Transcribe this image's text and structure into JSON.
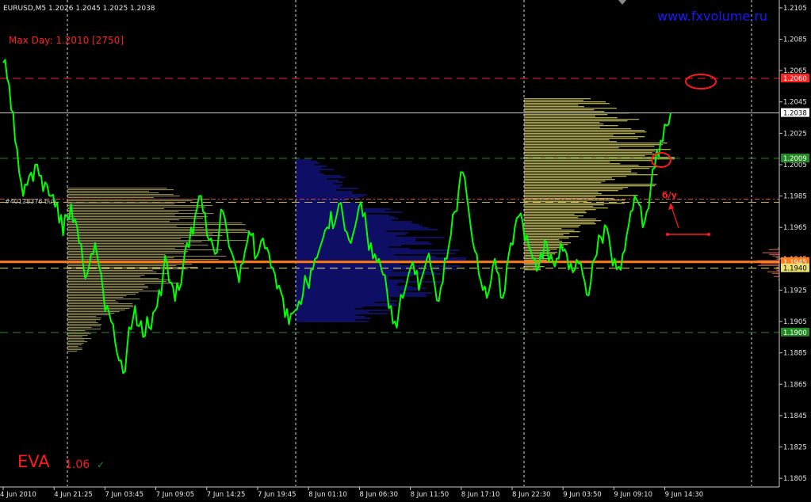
{
  "header": {
    "symbol_info": "EURUSD,M5  1.2026 1.2045 1.2025 1.2038",
    "website": "www.fxvolume.ru",
    "max_day": "Max Day: 1.2010 [2750]",
    "trade_label": "#40128376 buy",
    "annotation": "б/у"
  },
  "footer": {
    "brand": "EVA",
    "version": "1.06",
    "check": "✓"
  },
  "colors": {
    "background": "#000000",
    "price_line": "#00ff00",
    "volume_yellow": "#e8e070",
    "volume_khaki": "#a09a58",
    "volume_blue": "#1c1cc8",
    "volume_red": "#d86a5a",
    "level_red": "#ff2020",
    "level_green": "#228b22",
    "level_orange": "#ff7a1a",
    "brand_red": "#ff1a1a",
    "website_blue": "#1a1aff"
  },
  "chart_data": {
    "type": "line",
    "title": "EURUSD,M5",
    "y_ticks": [
      "1.2105",
      "1.2085",
      "1.2065",
      "1.2045",
      "1.2025",
      "1.2005",
      "1.1985",
      "1.1965",
      "1.1945",
      "1.1925",
      "1.1905",
      "1.1885",
      "1.1865",
      "1.1845",
      "1.1825",
      "1.1805"
    ],
    "x_ticks": [
      "4 Jun 2010",
      "4 Jun 21:25",
      "7 Jun 03:45",
      "7 Jun 09:05",
      "7 Jun 14:25",
      "7 Jun 19:45",
      "8 Jun 01:10",
      "8 Jun 06:30",
      "8 Jun 11:50",
      "8 Jun 17:10",
      "8 Jun 22:30",
      "9 Jun 03:50",
      "9 Jun 09:10",
      "9 Jun 14:30"
    ],
    "ylim": [
      1.18,
      1.211
    ],
    "levels": [
      {
        "price": 1.206,
        "label": "1.2060",
        "color": "#ff2020",
        "style": "dash"
      },
      {
        "price": 1.2038,
        "label": "1.2038",
        "color": "#c8c8c8",
        "style": "solid"
      },
      {
        "price": 1.2009,
        "label": "1.2009",
        "color": "#228b22",
        "style": "dash"
      },
      {
        "price": 1.1983,
        "label": "",
        "color": "#c85050",
        "style": "dashdot"
      },
      {
        "price": 1.1981,
        "label": "",
        "color": "#d0b040",
        "style": "dash"
      },
      {
        "price": 1.1943,
        "label": "1.1945",
        "color": "#ff7a1a",
        "style": "solid"
      },
      {
        "price": 1.1939,
        "label": "1.1940",
        "color": "#e8e070",
        "style": "dash"
      },
      {
        "price": 1.1898,
        "label": "1.1900",
        "color": "#228b22",
        "style": "dash"
      }
    ],
    "series": [
      {
        "values": [
          1.207,
          1.206,
          1.204,
          1.202,
          1.2,
          1.1985,
          1.1992,
          1.2,
          1.2005,
          1.1998,
          1.1988,
          1.1992,
          1.1985,
          1.1978,
          1.1968,
          1.196,
          1.1972,
          1.198,
          1.197,
          1.1955,
          1.1942,
          1.1935,
          1.1948,
          1.1955,
          1.194,
          1.1925,
          1.1915,
          1.1905,
          1.1892,
          1.188,
          1.1872,
          1.1888,
          1.19,
          1.1915,
          1.1902,
          1.1895,
          1.1908,
          1.19,
          1.1912,
          1.1925,
          1.1935,
          1.1942,
          1.193,
          1.1918,
          1.1925,
          1.194,
          1.1955,
          1.1965,
          1.1972,
          1.1985,
          1.1975,
          1.196,
          1.1958,
          1.1948,
          1.1962,
          1.1975,
          1.1962,
          1.195,
          1.1942,
          1.193,
          1.1942,
          1.1955,
          1.196,
          1.1945,
          1.195,
          1.1958,
          1.1952,
          1.194,
          1.1935,
          1.1928,
          1.192,
          1.1913,
          1.191,
          1.1912,
          1.1918,
          1.1922,
          1.193,
          1.1938,
          1.1945,
          1.195,
          1.1958,
          1.1965,
          1.1975,
          1.1968,
          1.198,
          1.1972,
          1.1962,
          1.1955,
          1.1965,
          1.1978,
          1.1972,
          1.1962,
          1.1955,
          1.1948,
          1.1945,
          1.1935,
          1.1925,
          1.1915,
          1.1905,
          1.1912,
          1.192,
          1.193,
          1.194,
          1.1935,
          1.1925,
          1.1935,
          1.1945,
          1.194,
          1.1928,
          1.1918,
          1.193,
          1.1945,
          1.196,
          1.1975,
          1.199,
          1.2,
          1.1985,
          1.1965,
          1.195,
          1.1935,
          1.1925,
          1.192,
          1.193,
          1.1945,
          1.1935,
          1.192,
          1.194,
          1.1955,
          1.1965,
          1.1972,
          1.1968,
          1.196,
          1.195,
          1.1945,
          1.194,
          1.1945,
          1.1955,
          1.1948,
          1.194,
          1.1945,
          1.195,
          1.1948,
          1.1942,
          1.1938,
          1.1942,
          1.1935,
          1.1922,
          1.193,
          1.1945,
          1.196,
          1.1955,
          1.1965,
          1.195,
          1.1945,
          1.194,
          1.1948,
          1.196,
          1.1975,
          1.1985,
          1.198,
          1.1965,
          1.1975,
          1.199,
          1.2003,
          1.201,
          1.202,
          1.203,
          1.2038
        ]
      }
    ],
    "volume_profiles": [
      {
        "color": "#a09a58",
        "from": 1.1885,
        "to": 1.199,
        "peak": 1.1962,
        "peak_length": 0.6
      },
      {
        "color": "#1c1cc8",
        "from": 1.1905,
        "to": 1.2008,
        "peak": 1.1945,
        "peak_length": 0.45
      },
      {
        "color": "#e8e070",
        "from": 1.1937,
        "to": 1.2047,
        "peak": 1.2009,
        "peak_length": 0.5
      },
      {
        "color": "#d86a5a",
        "from": 1.1925,
        "to": 1.1965,
        "peak": 1.1943,
        "peak_length": 0.6
      }
    ],
    "grid": false
  }
}
